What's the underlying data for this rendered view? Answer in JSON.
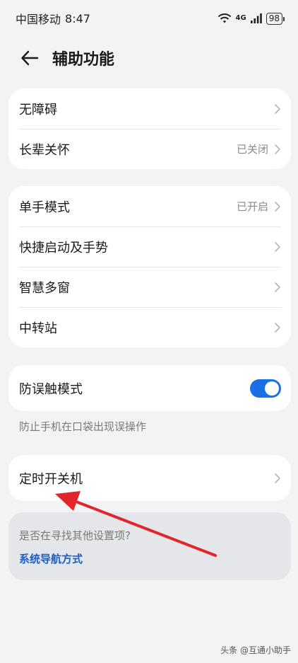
{
  "status_bar": {
    "carrier": "中国移动",
    "time": "8:47",
    "network": "4G",
    "battery": "98"
  },
  "header": {
    "title": "辅助功能"
  },
  "group1": {
    "items": [
      {
        "label": "无障碍",
        "value": ""
      },
      {
        "label": "长辈关怀",
        "value": "已关闭"
      }
    ]
  },
  "group2": {
    "items": [
      {
        "label": "单手模式",
        "value": "已开启"
      },
      {
        "label": "快捷启动及手势",
        "value": ""
      },
      {
        "label": "智慧多窗",
        "value": ""
      },
      {
        "label": "中转站",
        "value": ""
      }
    ]
  },
  "group3": {
    "label": "防误触模式",
    "toggle_on": true,
    "helper": "防止手机在口袋出现误操作"
  },
  "group4": {
    "label": "定时开关机"
  },
  "suggest": {
    "question": "是否在寻找其他设置项?",
    "link": "系统导航方式"
  },
  "watermark": "头条 @互通小助手",
  "colors": {
    "accent": "#1a6fe6",
    "link": "#1a5fc8",
    "annotation_arrow": "#e0262b",
    "background": "#f1f3f5"
  }
}
